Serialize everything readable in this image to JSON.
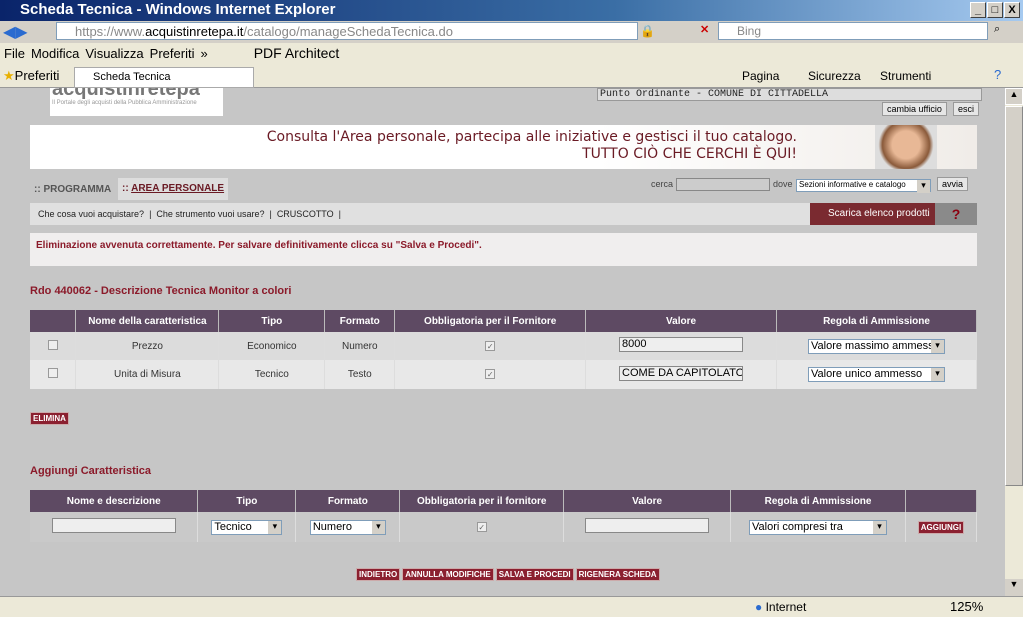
{
  "window": {
    "title": "Scheda Tecnica - Windows Internet Explorer"
  },
  "address": {
    "url_prefix": "https://www.",
    "url_domain": "acquistinretepa.it",
    "url_path": "/catalogo/manageSchedaTecnica.do",
    "search_placeholder": "Bing"
  },
  "menu": [
    "File",
    "Modifica",
    "Visualizza",
    "Preferiti",
    "»",
    "PDF Architect"
  ],
  "favorites": {
    "label": "Preferiti",
    "tab": "Scheda Tecnica",
    "tools": [
      "Pagina",
      "Sicurezza",
      "Strumenti"
    ]
  },
  "header": {
    "logo_text": "acquistinretepa",
    "logo_sub": "Il Portale degli acquisti della Pubblica Amministrazione",
    "office": "Punto Ordinante - COMUNE DI CITTADELLA",
    "change_office": "cambia ufficio",
    "exit": "esci"
  },
  "banner": {
    "line1": "Consulta l'Area personale, partecipa alle iniziative e gestisci il tuo catalogo.",
    "line2": "TUTTO CIÒ CHE CERCHI È QUI!"
  },
  "nav": {
    "tabs": [
      "PROGRAMMA",
      "AREA PERSONALE"
    ],
    "search_label": "cerca",
    "where_label": "dove",
    "where_value": "Sezioni informative e catalogo",
    "go": "avvia"
  },
  "subnav": {
    "links": [
      "Che cosa vuoi acquistare?",
      "Che strumento vuoi usare?",
      "CRUSCOTTO"
    ],
    "download": "Scarica elenco prodotti"
  },
  "message": "Eliminazione avvenuta correttamente. Per salvare definitivamente clicca su \"Salva e Procedi\".",
  "section1": {
    "title": "Rdo 440062 - Descrizione Tecnica Monitor a colori",
    "headers": [
      "",
      "Nome della caratteristica",
      "Tipo",
      "Formato",
      "Obbligatoria per il Fornitore",
      "Valore",
      "Regola di Ammissione"
    ],
    "rows": [
      {
        "name": "Prezzo",
        "tipo": "Economico",
        "formato": "Numero",
        "valore": "8000",
        "regola": "Valore massimo ammesso"
      },
      {
        "name": "Unita di Misura",
        "tipo": "Tecnico",
        "formato": "Testo",
        "valore": "COME DA CAPITOLATO T",
        "regola": "Valore unico ammesso"
      }
    ],
    "delete": "ELIMINA"
  },
  "section2": {
    "title": "Aggiungi Caratteristica",
    "headers": [
      "Nome e descrizione",
      "Tipo",
      "Formato",
      "Obbligatoria per il fornitore",
      "Valore",
      "Regola di Ammissione",
      ""
    ],
    "tipo": "Tecnico",
    "formato": "Numero",
    "regola": "Valori compresi tra",
    "add": "AGGIUNGI"
  },
  "actions": [
    "INDIETRO",
    "ANNULLA MODIFICHE",
    "SALVA E PROCEDI",
    "RIGENERA SCHEDA"
  ],
  "status": {
    "zone": "Internet",
    "zoom": "125%"
  }
}
